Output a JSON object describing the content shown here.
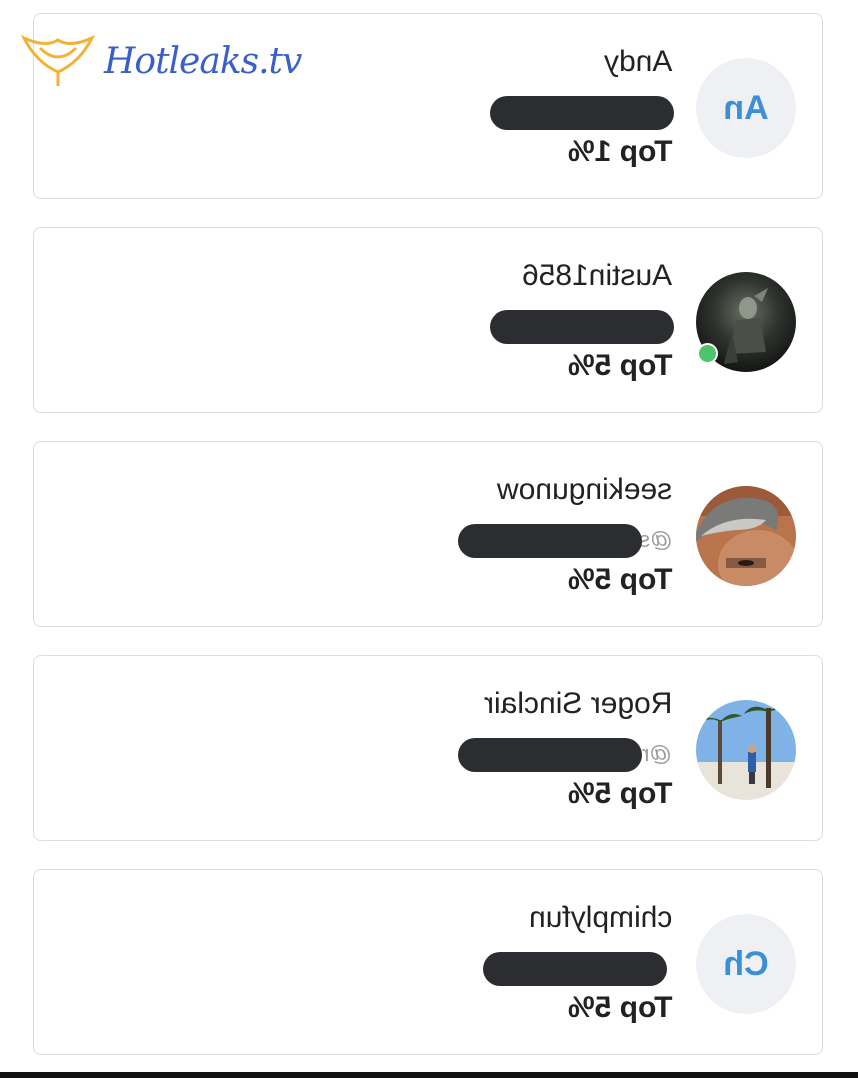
{
  "watermark": {
    "text": "Hotleaks.tv",
    "icon": "bikini-logo-icon",
    "color": "#3a5fc9"
  },
  "colors": {
    "card_border": "#dcdcdc",
    "redaction": "#2b2d30",
    "initials_text": "#3b8fd8",
    "initials_bg": "#eef0f3",
    "online": "#4cc46b"
  },
  "fans": [
    {
      "name": "Andy",
      "avatar_text": "An",
      "avatar_type": "initials",
      "rank": "Top 1%",
      "handle_prefix": "",
      "online": false
    },
    {
      "name": "Austin1856",
      "avatar_text": "",
      "avatar_type": "photo-dark-figure",
      "rank": "Top 5%",
      "handle_prefix": "",
      "online": true
    },
    {
      "name": "seekingunow",
      "avatar_text": "",
      "avatar_type": "photo-man-gray-hair",
      "rank": "Top 5%",
      "handle_prefix": "@s",
      "online": false
    },
    {
      "name": "Roger Sinclair",
      "avatar_text": "",
      "avatar_type": "photo-beach-palms",
      "rank": "Top 5%",
      "handle_prefix": "@r",
      "online": false
    },
    {
      "name": "chimplyfun",
      "avatar_text": "Ch",
      "avatar_type": "initials",
      "rank": "Top 5%",
      "handle_prefix": "",
      "online": false
    }
  ]
}
